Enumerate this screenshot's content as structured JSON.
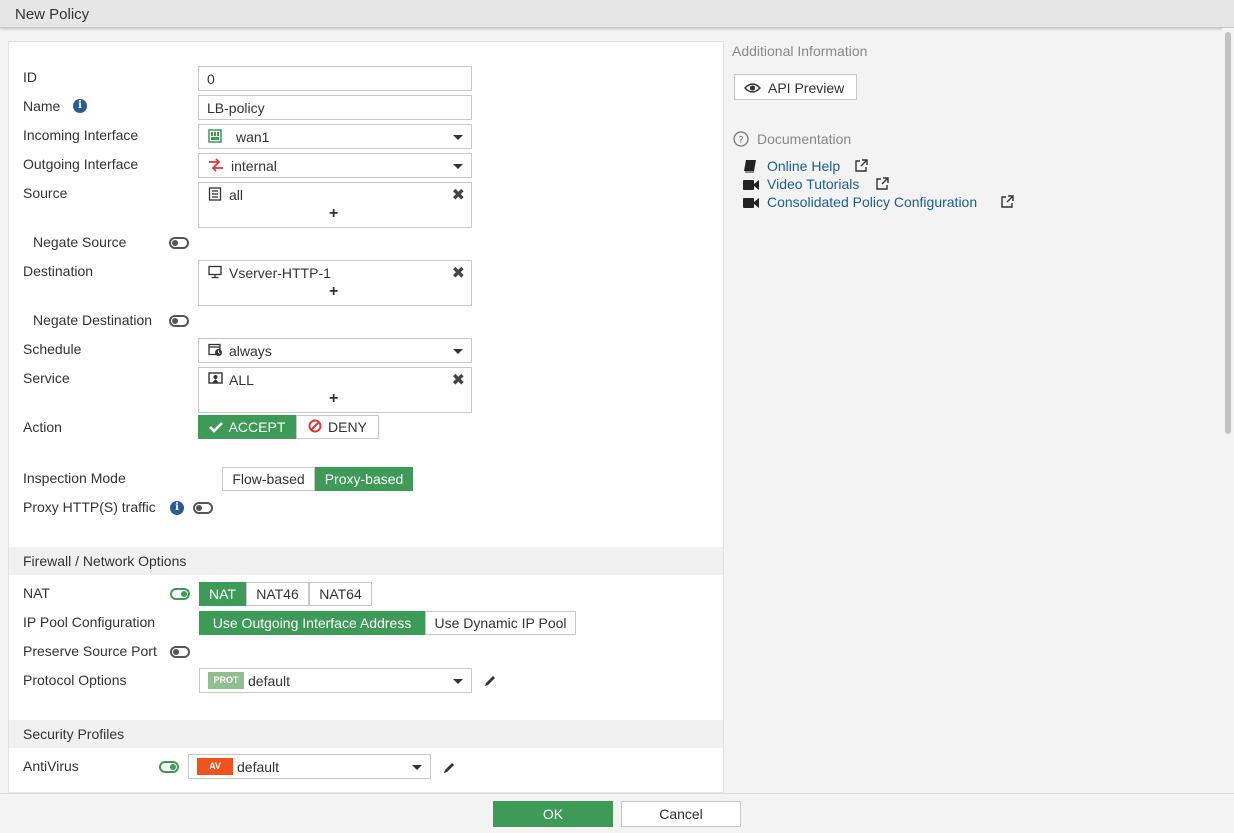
{
  "window": {
    "title": "New Policy"
  },
  "form": {
    "id": {
      "label": "ID",
      "value": "0"
    },
    "name": {
      "label": "Name",
      "value": "LB-policy"
    },
    "incoming_interface": {
      "label": "Incoming Interface",
      "value": "wan1",
      "icon": "port-icon"
    },
    "outgoing_interface": {
      "label": "Outgoing Interface",
      "value": "internal",
      "icon": "switch-icon"
    },
    "source": {
      "label": "Source",
      "value": "all",
      "icon": "address-icon"
    },
    "negate_source": {
      "label": "Negate Source",
      "enabled": false
    },
    "destination": {
      "label": "Destination",
      "value": "Vserver-HTTP-1",
      "icon": "monitor-icon"
    },
    "negate_destination": {
      "label": "Negate Destination",
      "enabled": false
    },
    "schedule": {
      "label": "Schedule",
      "value": "always",
      "icon": "schedule-icon"
    },
    "service": {
      "label": "Service",
      "value": "ALL",
      "icon": "service-icon"
    },
    "action": {
      "label": "Action",
      "accept": "ACCEPT",
      "deny": "DENY",
      "selected": "ACCEPT"
    },
    "inspection_mode": {
      "label": "Inspection Mode",
      "options": [
        "Flow-based",
        "Proxy-based"
      ],
      "selected": "Proxy-based"
    },
    "proxy_http": {
      "label": "Proxy HTTP(S) traffic",
      "enabled": false
    }
  },
  "firewall_section": {
    "title": "Firewall / Network Options",
    "nat": {
      "label": "NAT",
      "enabled": true,
      "options": [
        "NAT",
        "NAT46",
        "NAT64"
      ],
      "selected": "NAT"
    },
    "ip_pool": {
      "label": "IP Pool Configuration",
      "options": [
        "Use Outgoing Interface Address",
        "Use Dynamic IP Pool"
      ],
      "selected": "Use Outgoing Interface Address"
    },
    "preserve_source_port": {
      "label": "Preserve Source Port",
      "enabled": false
    },
    "protocol_options": {
      "label": "Protocol Options",
      "badge": "PROT",
      "value": "default"
    }
  },
  "security_section": {
    "title": "Security Profiles",
    "antivirus": {
      "label": "AntiVirus",
      "enabled": true,
      "badge": "AV",
      "value": "default"
    }
  },
  "side": {
    "additional_info": "Additional Information",
    "api_preview": "API Preview",
    "documentation": "Documentation",
    "links": [
      "Online Help",
      "Video Tutorials",
      "Consolidated Policy Configuration"
    ]
  },
  "footer": {
    "ok": "OK",
    "cancel": "Cancel"
  },
  "colors": {
    "accent_green": "#3e9a57",
    "link_blue": "#1d5d9b",
    "av_orange": "#f0541e",
    "prot_green": "#8fbf8f"
  }
}
